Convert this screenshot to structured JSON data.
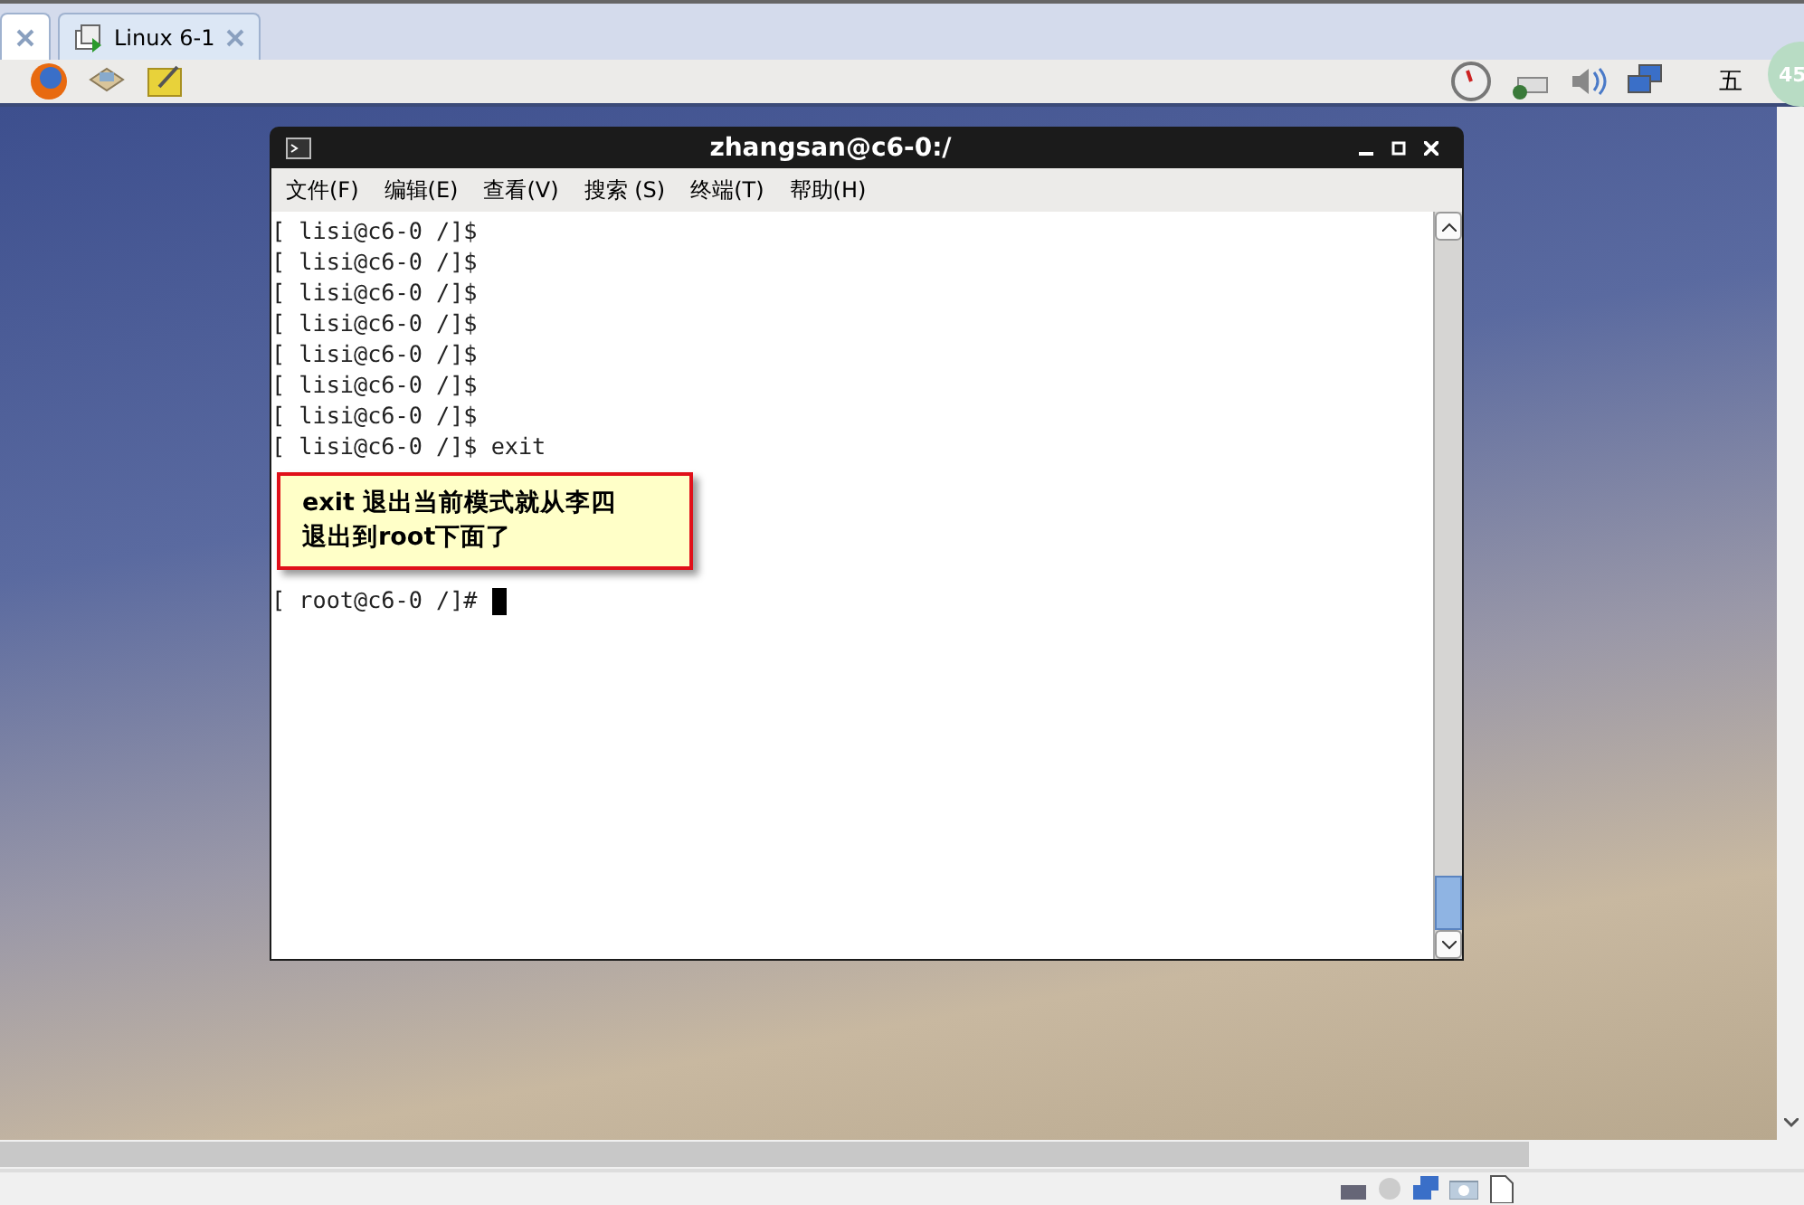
{
  "vm_tabs": [
    {
      "selected": false
    },
    {
      "label": "Linux 6-1",
      "selected": true
    }
  ],
  "tray": {
    "input_method": "五",
    "clock_badge": "45"
  },
  "terminal": {
    "title": "zhangsan@c6-0:/",
    "menu": [
      "文件(F)",
      "编辑(E)",
      "查看(V)",
      "搜索 (S)",
      "终端(T)",
      "帮助(H)"
    ],
    "lines": [
      "[ lisi@c6-0 /]$",
      "[ lisi@c6-0 /]$",
      "[ lisi@c6-0 /]$",
      "[ lisi@c6-0 /]$",
      "[ lisi@c6-0 /]$",
      "[ lisi@c6-0 /]$",
      "[ lisi@c6-0 /]$",
      "[ lisi@c6-0 /]$ exit"
    ],
    "current_prompt": "[ root@c6-0 /]#",
    "callout": [
      "exit 退出当前模式就从李四",
      "退出到root下面了"
    ]
  }
}
